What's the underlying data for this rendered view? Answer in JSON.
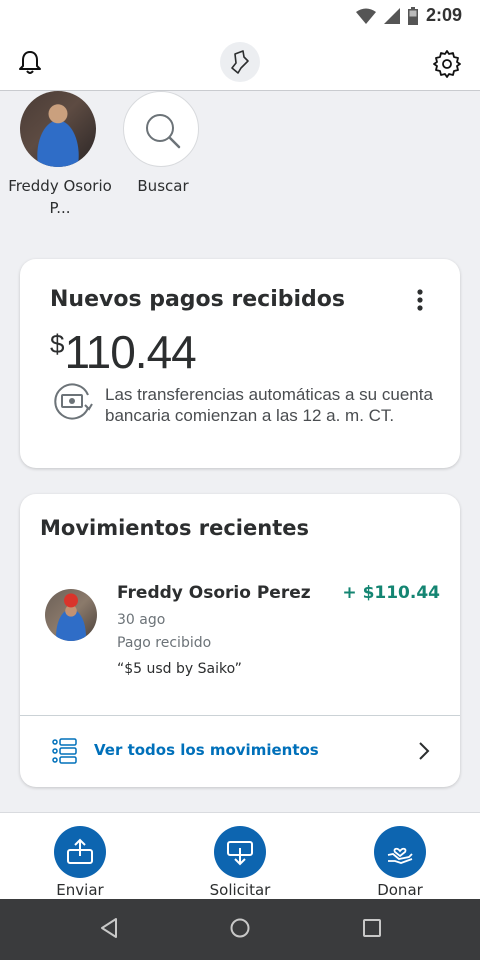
{
  "status_bar": {
    "time": "2:09"
  },
  "top_bar": {
    "notifications_icon": "bell-icon",
    "logo_icon": "paypal-logo-icon",
    "settings_icon": "gear-icon"
  },
  "contacts": [
    {
      "name": "Freddy Osorio P...",
      "icon": "avatar"
    },
    {
      "name": "Buscar",
      "icon": "search-icon"
    }
  ],
  "balance_card": {
    "title": "Nuevos pagos recibidos",
    "currency_symbol": "$",
    "amount": "110.44",
    "transfer_note": "Las transferencias automáticas a su cuenta bancaria comienzan a las 12 a. m. CT.",
    "menu_icon": "more-vertical-icon"
  },
  "activity_card": {
    "title": "Movimientos recientes",
    "transactions": [
      {
        "name": "Freddy Osorio Perez",
        "amount": "+ $110.44",
        "date": "30 ago",
        "type": "Pago recibido",
        "note": "“$5 usd by Saiko”"
      }
    ],
    "see_all": "Ver todos los movimientos"
  },
  "bottom_nav": [
    {
      "label": "Enviar",
      "icon": "send-icon"
    },
    {
      "label": "Solicitar",
      "icon": "request-icon"
    },
    {
      "label": "Donar",
      "icon": "donate-icon"
    }
  ],
  "colors": {
    "brand_blue": "#0070ba",
    "nav_button_blue": "#0d65b0",
    "positive_green": "#148572",
    "background": "#eff0f3"
  }
}
